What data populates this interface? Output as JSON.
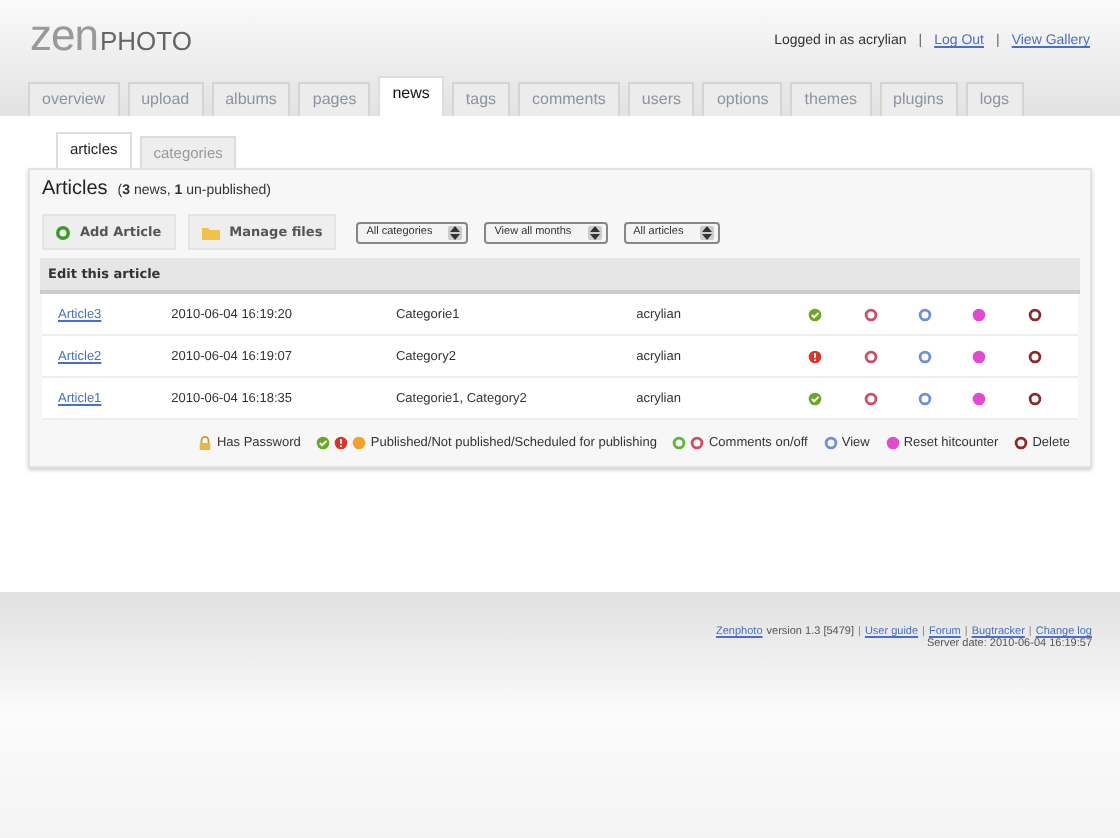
{
  "logo": {
    "part_1": "zen",
    "part_2": "PHOTO"
  },
  "user_bar": {
    "logged_in": "Logged in as acrylian",
    "separator_1": "|",
    "log_out": "Log Out",
    "separator_2": "|",
    "view_gallery": "View Gallery"
  },
  "tabs": [
    {
      "label": "overview",
      "selected": false
    },
    {
      "label": "upload",
      "selected": false
    },
    {
      "label": "albums",
      "selected": false
    },
    {
      "label": "pages",
      "selected": false
    },
    {
      "label": "news",
      "selected": true
    },
    {
      "label": "tags",
      "selected": false
    },
    {
      "label": "comments",
      "selected": false
    },
    {
      "label": "users",
      "selected": false
    },
    {
      "label": "options",
      "selected": false
    },
    {
      "label": "themes",
      "selected": false
    },
    {
      "label": "plugins",
      "selected": false
    },
    {
      "label": "logs",
      "selected": false
    }
  ],
  "subtabs": [
    {
      "label": "articles",
      "selected": true
    },
    {
      "label": "categories",
      "selected": false
    }
  ],
  "heading": {
    "title": "Articles",
    "summary": "(**3** news, **1** un-published)"
  },
  "toolbar": {
    "buttons": [
      {
        "kind": "add",
        "label": "Add Article"
      },
      {
        "kind": "folder",
        "label": "Manage files"
      }
    ],
    "selects": [
      "All categories",
      "View all months",
      "All articles"
    ]
  },
  "table": {
    "header": "Edit this article",
    "rows": [
      {
        "title": "Article3",
        "date": "2010-06-04 16:19:20",
        "categories": "Categorie1",
        "author": "acrylian",
        "published": true,
        "comments_on": false
      },
      {
        "title": "Article2",
        "date": "2010-06-04 16:19:07",
        "categories": "Category2",
        "author": "acrylian",
        "published": false,
        "comments_on": false
      },
      {
        "title": "Article1",
        "date": "2010-06-04 16:18:35",
        "categories": "Categorie1, Category2",
        "author": "acrylian",
        "published": true,
        "comments_on": false
      }
    ]
  },
  "legend": [
    {
      "kind": "password",
      "label": "Has Password"
    },
    {
      "kind": "status",
      "label": "Published/Not published/Scheduled for publishing"
    },
    {
      "kind": "comments",
      "label": "Comments on/off"
    },
    {
      "kind": "view",
      "label": "View"
    },
    {
      "kind": "reset",
      "label": "Reset hitcounter"
    },
    {
      "kind": "delete",
      "label": "Delete"
    }
  ],
  "footer": {
    "brand": "Zenphoto",
    "version": "version 1.3 [5479]",
    "links": [
      {
        "separator": "|",
        "label": "User guide"
      },
      {
        "separator": "|",
        "label": "Forum"
      },
      {
        "separator": "|",
        "label": "Bugtracker"
      },
      {
        "separator": "|",
        "label": "Change log"
      }
    ],
    "server_date": "Server date: 2010-06-04 16:19:57"
  }
}
